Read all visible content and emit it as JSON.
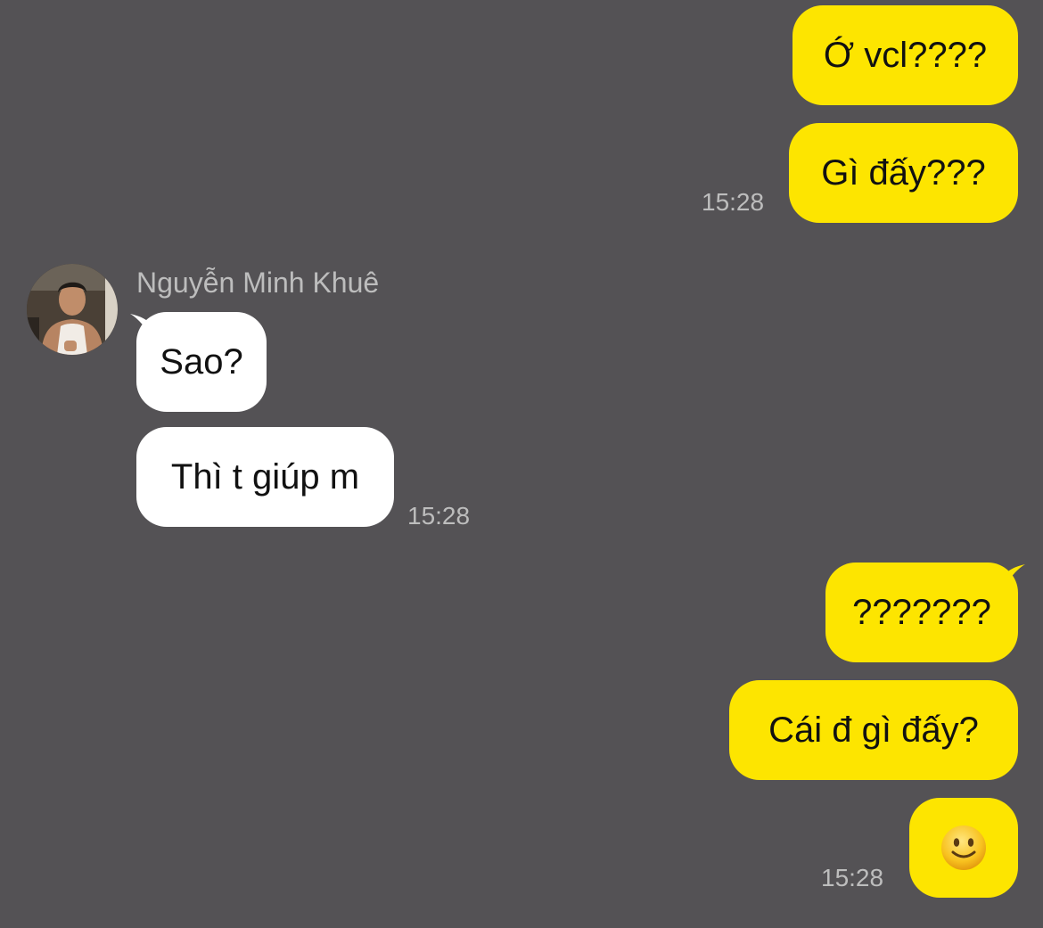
{
  "colors": {
    "background": "#545255",
    "outgoing_bubble": "#FDE500",
    "incoming_bubble": "#FFFFFF",
    "meta_text": "#BDBDBD"
  },
  "sender": {
    "name": "Nguyễn Minh Khuê"
  },
  "messages": [
    {
      "direction": "outgoing",
      "text": "Ớ vcl????"
    },
    {
      "direction": "outgoing",
      "text": "Gì đấy???",
      "time": "15:28"
    },
    {
      "direction": "incoming",
      "text": "Sao?"
    },
    {
      "direction": "incoming",
      "text": "Thì t giúp m",
      "time": "15:28"
    },
    {
      "direction": "outgoing",
      "text": "???????"
    },
    {
      "direction": "outgoing",
      "text": "Cái đ gì đấy?"
    },
    {
      "direction": "outgoing",
      "icon": "slightly-smiling-face-emoji",
      "time": "15:28"
    }
  ]
}
